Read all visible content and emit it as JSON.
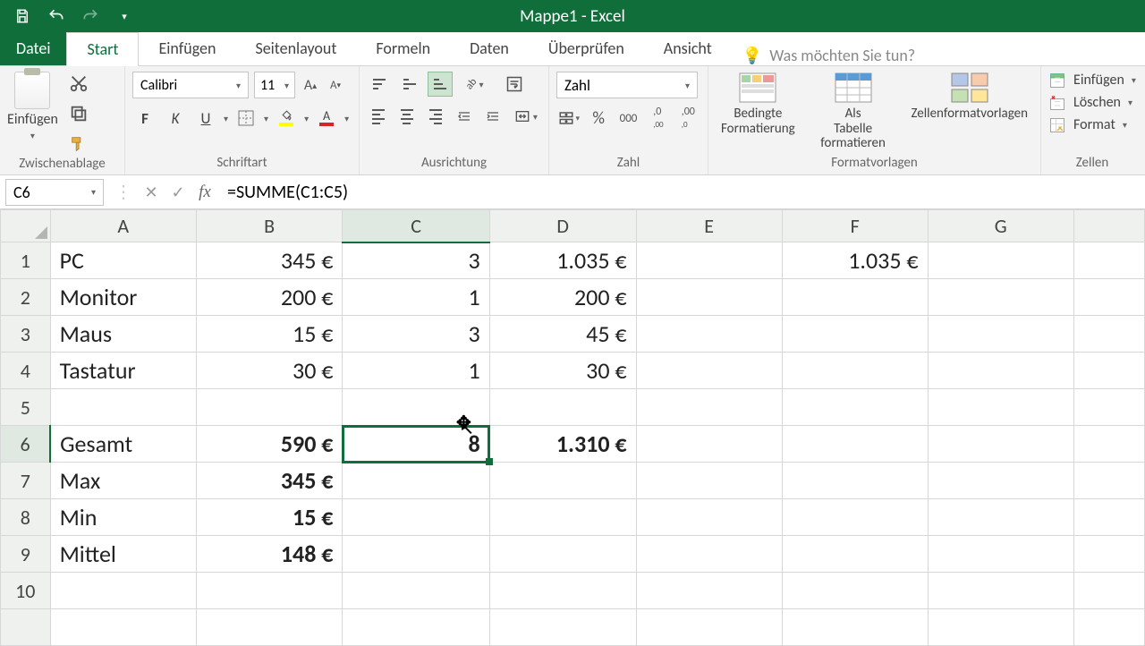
{
  "window_title": "Mappe1 - Excel",
  "tabs": {
    "file": "Datei",
    "home": "Start",
    "insert": "Einfügen",
    "pagelayout": "Seitenlayout",
    "formulas": "Formeln",
    "data": "Daten",
    "review": "Überprüfen",
    "view": "Ansicht"
  },
  "tell_me": "Was möchten Sie tun?",
  "ribbon": {
    "clipboard": {
      "label": "Zwischenablage",
      "paste": "Einfügen"
    },
    "font": {
      "label": "Schriftart",
      "name": "Calibri",
      "size": "11",
      "bold": "F",
      "italic": "K",
      "underline": "U"
    },
    "alignment": {
      "label": "Ausrichtung"
    },
    "number": {
      "label": "Zahl",
      "format": "Zahl",
      "percent": "%",
      "thousands": "000",
      "inc_dec_left": "←0",
      "inc_dec_right": "→0"
    },
    "styles": {
      "label": "Formatvorlagen",
      "conditional": "Bedingte Formatierung",
      "astable": "Als Tabelle formatieren",
      "cellstyles": "Zellenformatvorlagen"
    },
    "cells": {
      "label": "Zellen",
      "insert": "Einfügen",
      "delete": "Löschen",
      "format": "Format"
    }
  },
  "namebox": "C6",
  "formula": "=SUMME(C1:C5)",
  "columns": [
    "A",
    "B",
    "C",
    "D",
    "E",
    "F",
    "G"
  ],
  "rows": [
    "1",
    "2",
    "3",
    "4",
    "5",
    "6",
    "7",
    "8",
    "9",
    "10"
  ],
  "cells": {
    "A1": "PC",
    "B1": "345 €",
    "C1": "3",
    "D1": "1.035 €",
    "F1": "1.035 €",
    "A2": "Monitor",
    "B2": "200 €",
    "C2": "1",
    "D2": "200 €",
    "A3": "Maus",
    "B3": "15 €",
    "C3": "3",
    "D3": "45 €",
    "A4": "Tastatur",
    "B4": "30 €",
    "C4": "1",
    "D4": "30 €",
    "A6": "Gesamt",
    "B6": "590 €",
    "C6": "8",
    "D6": "1.310 €",
    "A7": "Max",
    "B7": "345 €",
    "A8": "Min",
    "B8": "15 €",
    "A9": "Mittel",
    "B9": "148 €"
  }
}
